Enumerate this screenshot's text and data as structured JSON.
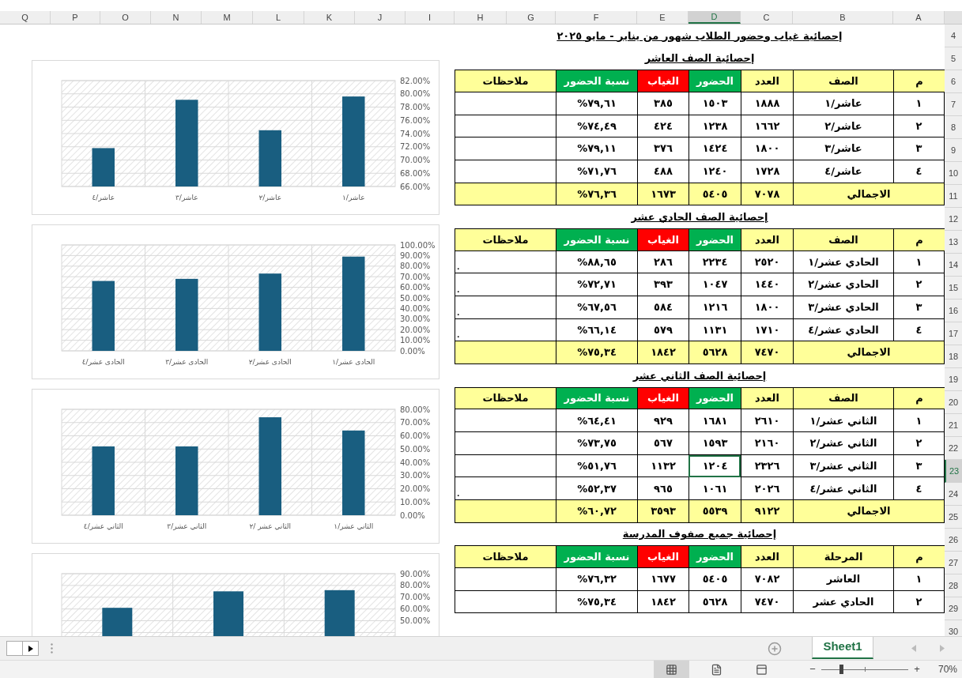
{
  "column_headers": [
    {
      "label": "A",
      "selected": false
    },
    {
      "label": "B",
      "selected": false
    },
    {
      "label": "C",
      "selected": false
    },
    {
      "label": "D",
      "selected": true
    },
    {
      "label": "E",
      "selected": false
    },
    {
      "label": "F",
      "selected": false
    },
    {
      "label": "G",
      "selected": false
    },
    {
      "label": "H",
      "selected": false
    },
    {
      "label": "I",
      "selected": false
    },
    {
      "label": "J",
      "selected": false
    },
    {
      "label": "K",
      "selected": false
    },
    {
      "label": "L",
      "selected": false
    },
    {
      "label": "M",
      "selected": false
    },
    {
      "label": "N",
      "selected": false
    },
    {
      "label": "O",
      "selected": false
    },
    {
      "label": "P",
      "selected": false
    },
    {
      "label": "Q",
      "selected": false
    }
  ],
  "row_numbers": [
    {
      "label": "4",
      "selected": false
    },
    {
      "label": "5",
      "selected": false
    },
    {
      "label": "6",
      "selected": false
    },
    {
      "label": "7",
      "selected": false
    },
    {
      "label": "8",
      "selected": false
    },
    {
      "label": "9",
      "selected": false
    },
    {
      "label": "10",
      "selected": false
    },
    {
      "label": "11",
      "selected": false
    },
    {
      "label": "12",
      "selected": false
    },
    {
      "label": "13",
      "selected": false
    },
    {
      "label": "14",
      "selected": false
    },
    {
      "label": "15",
      "selected": false
    },
    {
      "label": "16",
      "selected": false
    },
    {
      "label": "17",
      "selected": false
    },
    {
      "label": "18",
      "selected": false
    },
    {
      "label": "19",
      "selected": false
    },
    {
      "label": "20",
      "selected": false
    },
    {
      "label": "21",
      "selected": false
    },
    {
      "label": "22",
      "selected": false
    },
    {
      "label": "23",
      "selected": true
    },
    {
      "label": "24",
      "selected": false
    },
    {
      "label": "25",
      "selected": false
    },
    {
      "label": "26",
      "selected": false
    },
    {
      "label": "27",
      "selected": false
    },
    {
      "label": "28",
      "selected": false
    },
    {
      "label": "29",
      "selected": false
    },
    {
      "label": "30",
      "selected": false
    }
  ],
  "title": "إحصائية غياب وحضور الطلاب شهور من يناير - مايو ٢٠٢٥",
  "sections": [
    {
      "title": "إحصائية الصف العاشر",
      "columns": [
        {
          "label": "م",
          "color": "#ffff99"
        },
        {
          "label": "الصف",
          "color": "#ffff99"
        },
        {
          "label": "العدد",
          "color": "#ffff99"
        },
        {
          "label": "الحضور",
          "color": "#00b050"
        },
        {
          "label": "الغياب",
          "color": "#ff0000"
        },
        {
          "label": "نسبة الحضور",
          "color": "#00b050"
        },
        {
          "label": "ملاحظات",
          "color": "#ffff99"
        }
      ],
      "rows": [
        {
          "cells": [
            "١",
            "عاشر/١",
            "١٨٨٨",
            "١٥٠٣",
            "٣٨٥",
            "%٧٩,٦١"
          ]
        },
        {
          "cells": [
            "٢",
            "عاشر/٢",
            "١٦٦٢",
            "١٢٣٨",
            "٤٢٤",
            "%٧٤,٤٩"
          ]
        },
        {
          "cells": [
            "٣",
            "عاشر/٣",
            "١٨٠٠",
            "١٤٢٤",
            "٣٧٦",
            "%٧٩,١١"
          ]
        },
        {
          "cells": [
            "٤",
            "عاشر/٤",
            "١٧٢٨",
            "١٢٤٠",
            "٤٨٨",
            "%٧١,٧٦"
          ]
        }
      ],
      "total": {
        "label": "الاجمالي",
        "cells": [
          "٧٠٧٨",
          "٥٤٠٥",
          "١٦٧٣",
          "%٧٦,٣٦"
        ]
      }
    },
    {
      "title": "إحصائية الصف الحادي عشر",
      "columns": [
        {
          "label": "م",
          "color": "#ffff99"
        },
        {
          "label": "الصف",
          "color": "#ffff99"
        },
        {
          "label": "العدد",
          "color": "#ffff99"
        },
        {
          "label": "الحضور",
          "color": "#00b050"
        },
        {
          "label": "الغياب",
          "color": "#ff0000"
        },
        {
          "label": "نسبة الحضور",
          "color": "#00b050"
        },
        {
          "label": "ملاحظات",
          "color": "#ffff99"
        }
      ],
      "rows": [
        {
          "cells": [
            "١",
            "الحادي عشر/١",
            "٢٥٢٠",
            "٢٢٣٤",
            "٢٨٦",
            "%٨٨,٦٥"
          ],
          "note": "."
        },
        {
          "cells": [
            "٢",
            "الحادي عشر/٢",
            "١٤٤٠",
            "١٠٤٧",
            "٣٩٣",
            "%٧٢,٧١"
          ],
          "note": "."
        },
        {
          "cells": [
            "٣",
            "الحادي عشر/٣",
            "١٨٠٠",
            "١٢١٦",
            "٥٨٤",
            "%٦٧,٥٦"
          ],
          "note": "."
        },
        {
          "cells": [
            "٤",
            "الحادي عشر/٤",
            "١٧١٠",
            "١١٣١",
            "٥٧٩",
            "%٦٦,١٤"
          ],
          "note": "."
        }
      ],
      "total": {
        "label": "الاجمالي",
        "cells": [
          "٧٤٧٠",
          "٥٦٢٨",
          "١٨٤٢",
          "%٧٥,٣٤"
        ]
      }
    },
    {
      "title": "إحصائية الصف الثاني عشر",
      "columns": [
        {
          "label": "م",
          "color": "#ffff99"
        },
        {
          "label": "الصف",
          "color": "#ffff99"
        },
        {
          "label": "العدد",
          "color": "#ffff99"
        },
        {
          "label": "الحضور",
          "color": "#00b050"
        },
        {
          "label": "الغياب",
          "color": "#ff0000"
        },
        {
          "label": "نسبة الحضور",
          "color": "#00b050"
        },
        {
          "label": "ملاحظات",
          "color": "#ffff99"
        }
      ],
      "rows": [
        {
          "cells": [
            "١",
            "الثاني عشر/١",
            "٢٦١٠",
            "١٦٨١",
            "٩٢٩",
            "%٦٤,٤١"
          ]
        },
        {
          "cells": [
            "٢",
            "الثاني عشر/٢",
            "٢١٦٠",
            "١٥٩٣",
            "٥٦٧",
            "%٧٣,٧٥"
          ]
        },
        {
          "cells": [
            "٣",
            "الثاني عشر/٣",
            "٢٣٢٦",
            "١٢٠٤",
            "١١٣٢",
            "%٥١,٧٦"
          ]
        },
        {
          "cells": [
            "٤",
            "الثاني عشر/٤",
            "٢٠٢٦",
            "١٠٦١",
            "٩٦٥",
            "%٥٢,٣٧"
          ],
          "note": "."
        }
      ],
      "total": {
        "label": "الاجمالي",
        "cells": [
          "٩١٢٢",
          "٥٥٣٩",
          "٣٥٩٣",
          "%٦٠,٧٢"
        ]
      }
    },
    {
      "title": "إحصائية جميع صفوف المدرسة",
      "columns": [
        {
          "label": "م",
          "color": "#ffff99"
        },
        {
          "label": "المرحلة",
          "color": "#ffff99"
        },
        {
          "label": "العدد",
          "color": "#ffff99"
        },
        {
          "label": "الحضور",
          "color": "#00b050"
        },
        {
          "label": "الغياب",
          "color": "#ff0000"
        },
        {
          "label": "نسبة الحضور",
          "color": "#00b050"
        },
        {
          "label": "ملاحظات",
          "color": "#ffff99"
        }
      ],
      "rows": [
        {
          "cells": [
            "١",
            "العاشر",
            "٧٠٨٢",
            "٥٤٠٥",
            "١٦٧٧",
            "%٧٦,٣٢"
          ]
        },
        {
          "cells": [
            "٢",
            "الحادي عشر",
            "٧٤٧٠",
            "٥٦٢٨",
            "١٨٤٢",
            "%٧٥,٣٤"
          ]
        }
      ]
    }
  ],
  "charts": [
    {
      "chart_data": {
        "type": "bar",
        "grid": true,
        "categories": [
          "عاشر/٤",
          "عاشر/٣",
          "عاشر/٢",
          "عاشر/١"
        ],
        "values": [
          71.8,
          79.1,
          74.5,
          79.6
        ],
        "ylim": [
          66,
          82
        ],
        "yticks": [
          {
            "value": 66,
            "label": "66.00%"
          },
          {
            "value": 68,
            "label": "68.00%"
          },
          {
            "value": 70,
            "label": "70.00%"
          },
          {
            "value": 72,
            "label": "72.00%"
          },
          {
            "value": 74,
            "label": "74.00%"
          },
          {
            "value": 76,
            "label": "76.00%"
          },
          {
            "value": 78,
            "label": "78.00%"
          },
          {
            "value": 80,
            "label": "80.00%"
          },
          {
            "value": 82,
            "label": "82.00%"
          }
        ]
      }
    },
    {
      "chart_data": {
        "type": "bar",
        "grid": true,
        "categories": [
          "الحادى عشر/٤",
          "الحادى عشر/٣",
          "الحادى عشر/٢",
          "الحادى عشر/١"
        ],
        "values": [
          66,
          68,
          73,
          89
        ],
        "ylim": [
          0,
          100
        ],
        "yticks": [
          {
            "value": 0,
            "label": "0.00%"
          },
          {
            "value": 10,
            "label": "10.00%"
          },
          {
            "value": 20,
            "label": "20.00%"
          },
          {
            "value": 30,
            "label": "30.00%"
          },
          {
            "value": 40,
            "label": "40.00%"
          },
          {
            "value": 50,
            "label": "50.00%"
          },
          {
            "value": 60,
            "label": "60.00%"
          },
          {
            "value": 70,
            "label": "70.00%"
          },
          {
            "value": 80,
            "label": "80.00%"
          },
          {
            "value": 90,
            "label": "90.00%"
          },
          {
            "value": 100,
            "label": "100.00%"
          }
        ]
      }
    },
    {
      "chart_data": {
        "type": "bar",
        "grid": true,
        "categories": [
          "الثاني عشر/٤",
          "الثاني عشر/٣",
          "الثاني عشر /٢",
          "الثاني عشر/١"
        ],
        "values": [
          52,
          52,
          74,
          64
        ],
        "ylim": [
          0,
          80
        ],
        "yticks": [
          {
            "value": 0,
            "label": "0.00%"
          },
          {
            "value": 10,
            "label": "10.00%"
          },
          {
            "value": 20,
            "label": "20.00%"
          },
          {
            "value": 30,
            "label": "30.00%"
          },
          {
            "value": 40,
            "label": "40.00%"
          },
          {
            "value": 50,
            "label": "50.00%"
          },
          {
            "value": 60,
            "label": "60.00%"
          },
          {
            "value": 70,
            "label": "70.00%"
          },
          {
            "value": 80,
            "label": "80.00%"
          }
        ]
      }
    },
    {
      "chart_data": {
        "type": "bar",
        "grid": true,
        "values": [
          61,
          75,
          76
        ],
        "ylim": [
          0,
          90
        ],
        "yticks": [
          {
            "value": 50,
            "label": "50.00%"
          },
          {
            "value": 60,
            "label": "60.00%"
          },
          {
            "value": 70,
            "label": "70.00%"
          },
          {
            "value": 80,
            "label": "80.00%"
          },
          {
            "value": 90,
            "label": "90.00%"
          }
        ]
      }
    }
  ],
  "sheet_tabs": [
    {
      "label": "Sheet1",
      "selected": true
    }
  ],
  "status_bar": {
    "views": [
      {
        "kind": "normal",
        "selected": true
      },
      {
        "kind": "page_layout",
        "selected": false
      },
      {
        "kind": "page_break",
        "selected": false
      }
    ],
    "zoom": {
      "minus": "−",
      "plus": "+",
      "level": 0.23,
      "reading": "70%"
    }
  }
}
